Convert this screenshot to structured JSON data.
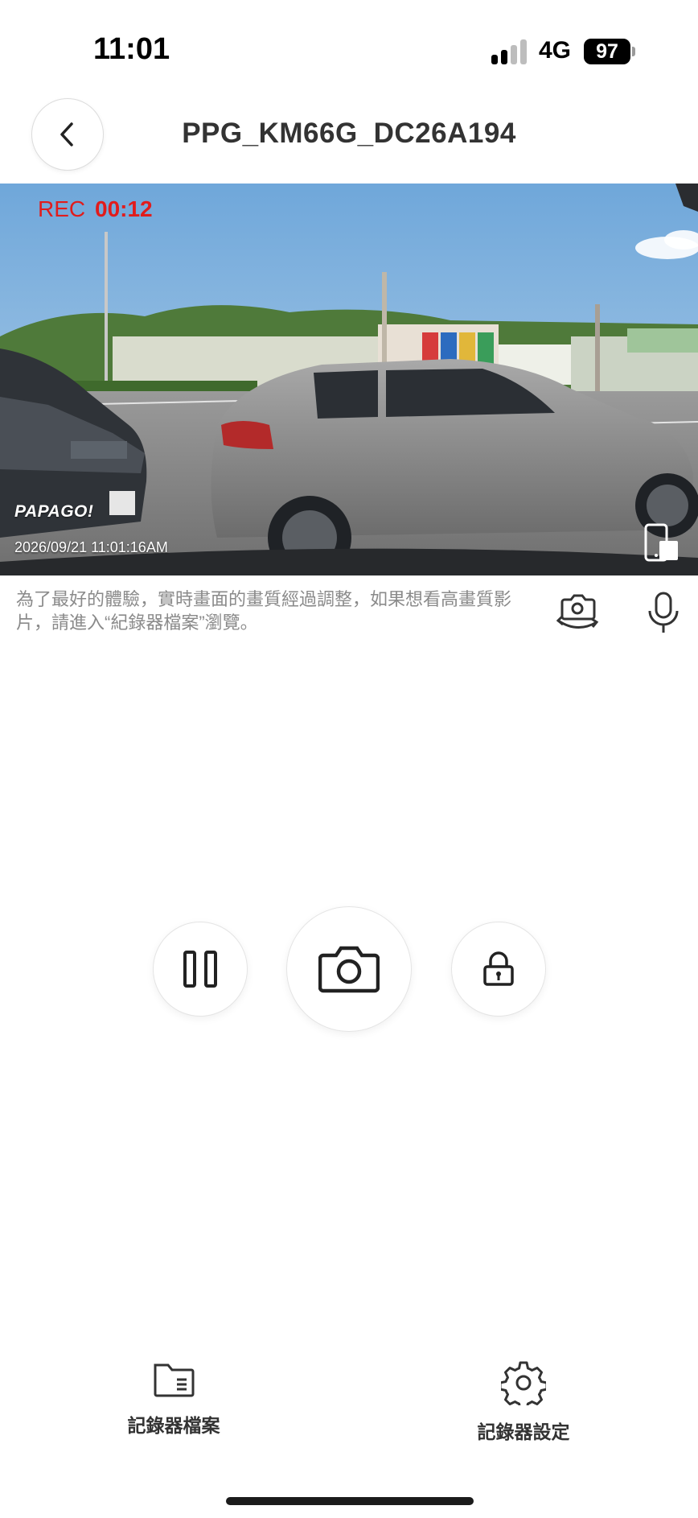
{
  "status": {
    "time": "11:01",
    "network": "4G",
    "battery": "97",
    "signal_bars_active": 2,
    "signal_bars_total": 4
  },
  "header": {
    "title": "PPG_KM66G_DC26A194"
  },
  "video": {
    "rec_label": "REC",
    "rec_time": "00:12",
    "brand": "PAPAGO!",
    "timestamp": "2026/09/21  11:01:16AM"
  },
  "hint": "為了最好的體驗，實時畫面的畫質經過調整，如果想看高畫質影片，請進入“紀錄器檔案”瀏覽。",
  "controls": {
    "pause": "pause-icon",
    "snapshot": "camera-icon",
    "lock": "lock-icon",
    "switch_camera": "camera-switch-icon",
    "microphone": "microphone-icon"
  },
  "bottom_nav": {
    "files_label": "記錄器檔案",
    "settings_label": "記錄器設定"
  },
  "colors": {
    "rec": "#e11c1c",
    "text": "#333333",
    "hint": "#8a8a8a"
  }
}
